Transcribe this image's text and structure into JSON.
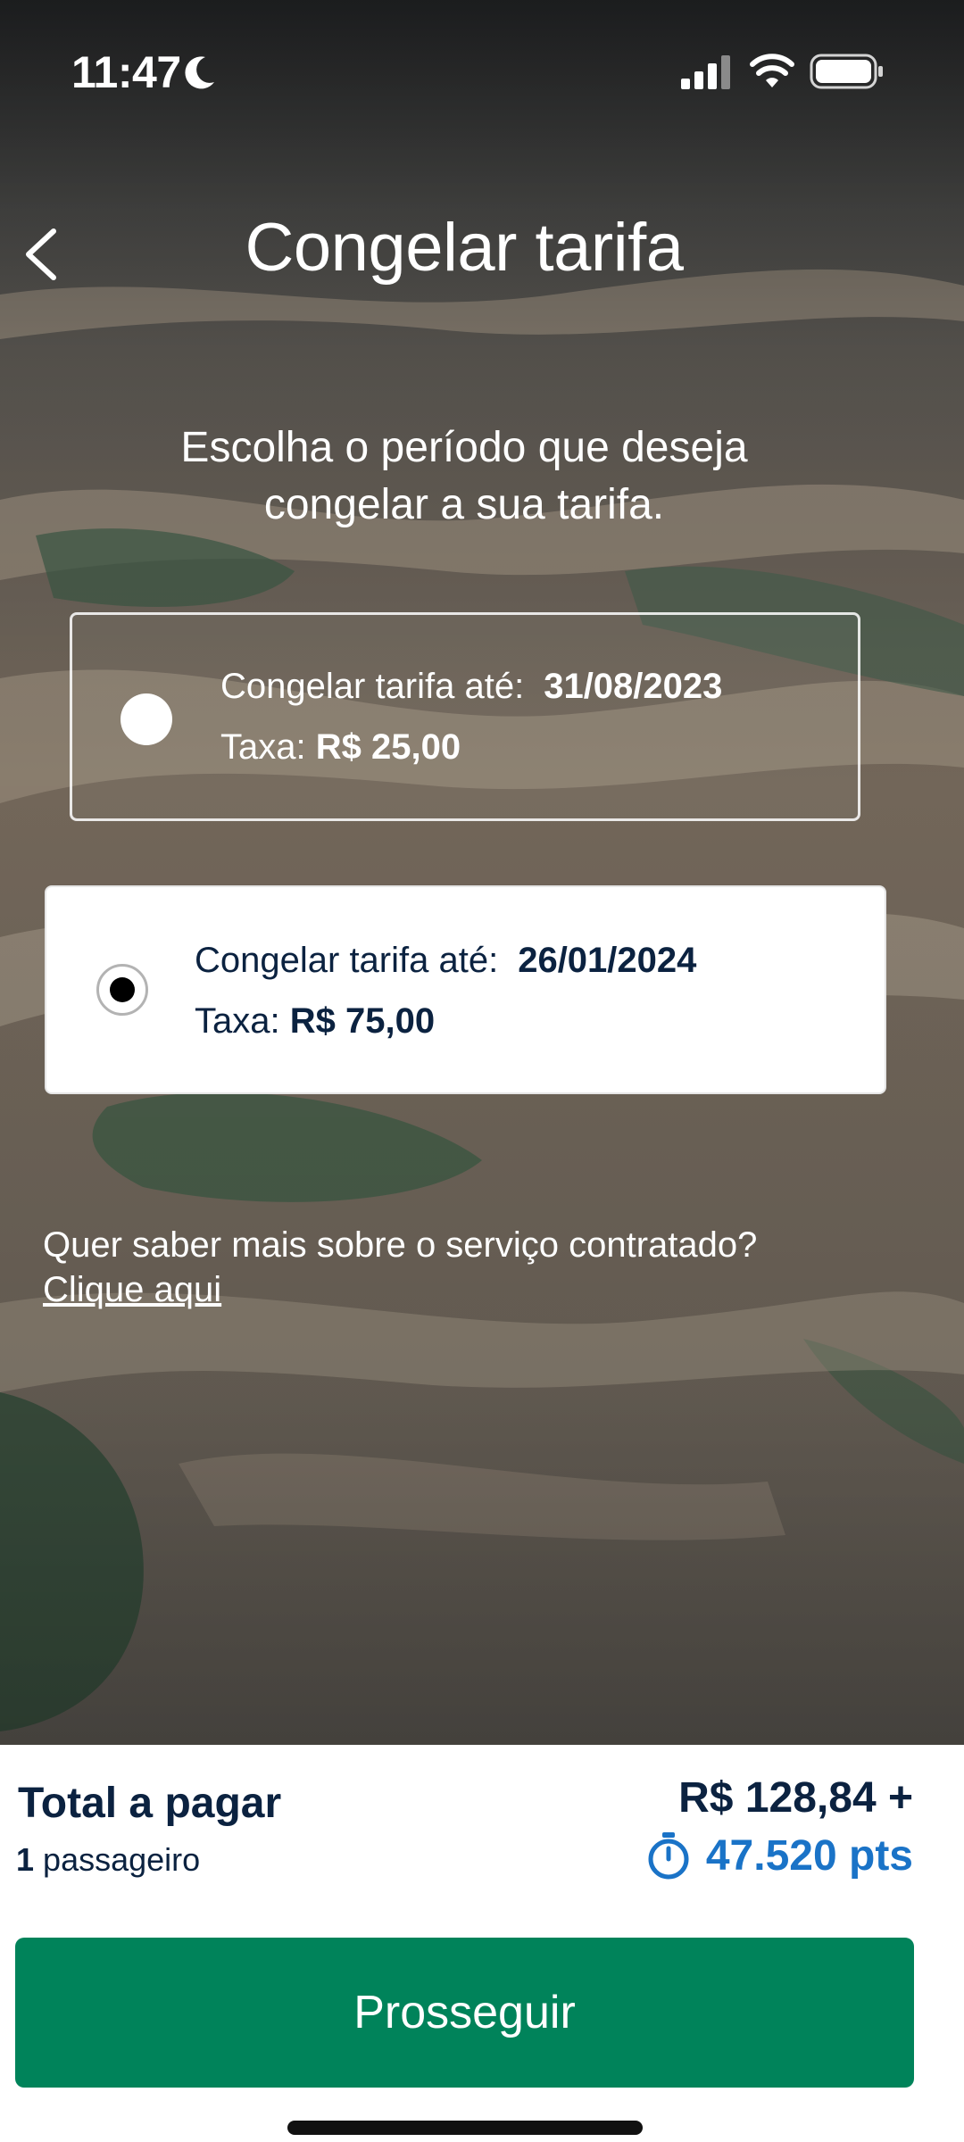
{
  "status_bar": {
    "time": "11:47"
  },
  "header": {
    "title": "Congelar tarifa"
  },
  "instruction": "Escolha o período que deseja congelar a sua tarifa.",
  "options": [
    {
      "label": "Congelar tarifa até:",
      "date": "31/08/2023",
      "fee_label": "Taxa:",
      "fee": "R$ 25,00",
      "selected": false
    },
    {
      "label": "Congelar tarifa até:",
      "date": "26/01/2024",
      "fee_label": "Taxa:",
      "fee": "R$ 75,00",
      "selected": true
    }
  ],
  "info": {
    "question": "Quer saber mais sobre o serviço contratado?",
    "link": "Clique aqui"
  },
  "summary": {
    "total_label": "Total a pagar",
    "passenger_count": "1",
    "passenger_label": "passageiro",
    "price": "R$ 128,84 +",
    "points": "47.520 pts"
  },
  "proceed_button": "Prosseguir",
  "colors": {
    "brand_green": "#00835a",
    "navy": "#0b2240",
    "points_blue": "#1a73c7"
  }
}
